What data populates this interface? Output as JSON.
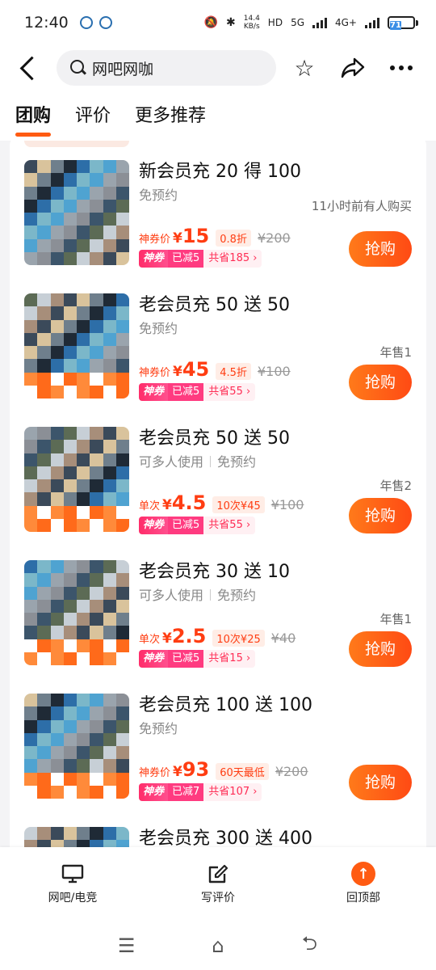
{
  "status_bar": {
    "time": "12:40",
    "net_speed_top": "14.4",
    "net_speed_bottom": "KB/s",
    "hd_label": "HD",
    "net_5g": "5G",
    "net_4g": "4G+",
    "battery": "71"
  },
  "header": {
    "search_text": "网吧网咖",
    "back_icon": "back-arrow-icon",
    "star_icon": "star-icon",
    "share_icon": "share-icon",
    "more_icon": "more-icon"
  },
  "tabs": [
    {
      "label": "团购",
      "active": true
    },
    {
      "label": "评价",
      "active": false
    },
    {
      "label": "更多推荐",
      "active": false
    }
  ],
  "deals": [
    {
      "title": "新会员充 20 得 100",
      "tags": [
        "免预约"
      ],
      "sold": "11小时前有人购买",
      "price_label": "神券价",
      "price_currency": "¥",
      "price": "15",
      "discount": "0.8折",
      "old_price": "¥200",
      "coupon_brand": "神券",
      "coupon_reduce": "已减5",
      "coupon_save": "共省185 ›",
      "button": "抢购"
    },
    {
      "title": "老会员充 50 送 50",
      "tags": [
        "免预约"
      ],
      "sold": "年售1",
      "price_label": "神券价",
      "price_currency": "¥",
      "price": "45",
      "discount": "4.5折",
      "old_price": "¥100",
      "coupon_brand": "神券",
      "coupon_reduce": "已减5",
      "coupon_save": "共省55 ›",
      "button": "抢购"
    },
    {
      "title": "老会员充 50 送 50",
      "tags": [
        "可多人使用",
        "免预约"
      ],
      "sold": "年售2",
      "price_label": "单次",
      "price_currency": "¥",
      "price": "4.5",
      "discount": "10次¥45",
      "old_price": "¥100",
      "coupon_brand": "神券",
      "coupon_reduce": "已减5",
      "coupon_save": "共省55 ›",
      "button": "抢购"
    },
    {
      "title": "老会员充 30 送 10",
      "tags": [
        "可多人使用",
        "免预约"
      ],
      "sold": "年售1",
      "price_label": "单次",
      "price_currency": "¥",
      "price": "2.5",
      "discount": "10次¥25",
      "old_price": "¥40",
      "coupon_brand": "神券",
      "coupon_reduce": "已减5",
      "coupon_save": "共省15 ›",
      "button": "抢购"
    },
    {
      "title": "老会员充 100 送 100",
      "tags": [
        "免预约"
      ],
      "sold": "",
      "price_label": "神券价",
      "price_currency": "¥",
      "price": "93",
      "discount": "60天最低",
      "old_price": "¥200",
      "coupon_brand": "神券",
      "coupon_reduce": "已减7",
      "coupon_save": "共省107 ›",
      "button": "抢购"
    },
    {
      "title": "老会员充 300 送 400",
      "tags": [],
      "sold": "",
      "price_label": "",
      "price_currency": "",
      "price": "",
      "discount": "",
      "old_price": "",
      "coupon_brand": "",
      "coupon_reduce": "",
      "coupon_save": "",
      "button": ""
    }
  ],
  "bottom_bar": [
    {
      "label": "网吧/电竞",
      "icon": "monitor-icon"
    },
    {
      "label": "写评价",
      "icon": "edit-review-icon"
    },
    {
      "label": "回顶部",
      "icon": "back-to-top-icon"
    }
  ],
  "system_nav": {
    "menu_icon": "menu-icon",
    "home_icon": "home-icon",
    "back_icon": "back-icon"
  }
}
